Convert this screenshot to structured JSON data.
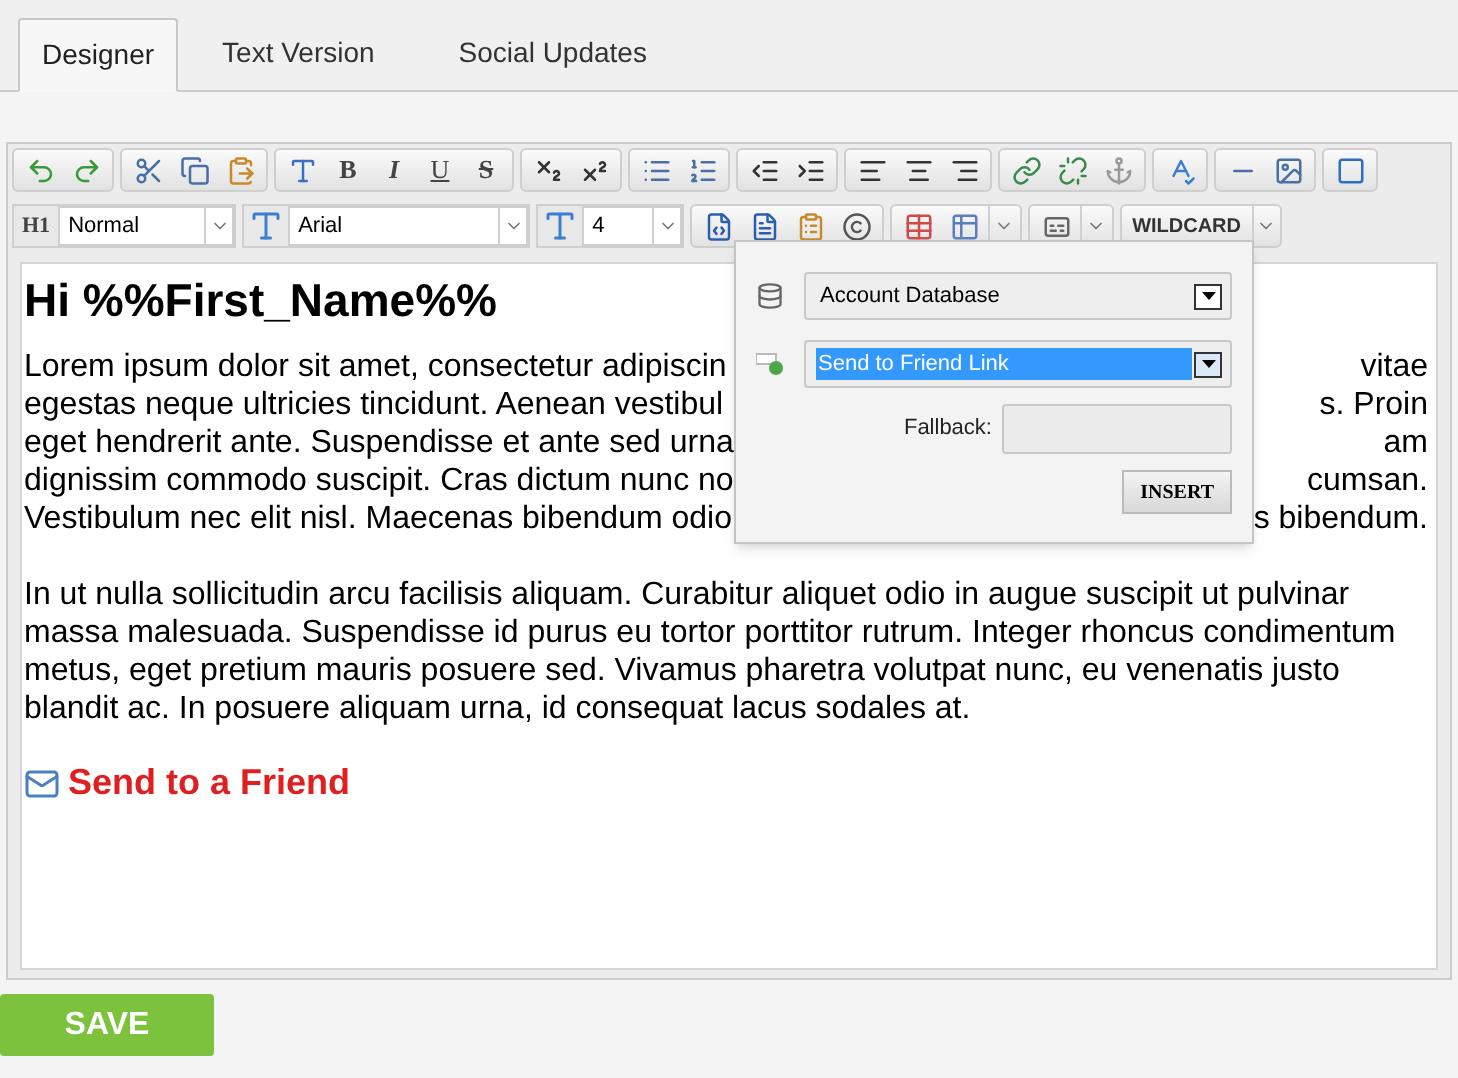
{
  "tabs": [
    {
      "label": "Designer",
      "selected": true
    },
    {
      "label": "Text Version",
      "selected": false
    },
    {
      "label": "Social Updates",
      "selected": false
    }
  ],
  "toolbar": {
    "style_buttons": [
      "B",
      "I",
      "U",
      "S"
    ],
    "heading_label": "H1",
    "format": "Normal",
    "font": "Arial",
    "size": "4",
    "wildcard": "WILDCARD"
  },
  "content": {
    "heading": "Hi %%First_Name%%",
    "paragraph_1_lines": [
      {
        "left": "Lorem ipsum dolor sit amet, consectetur adipiscin",
        "right": "vitae"
      },
      {
        "left": "egestas neque ultricies tincidunt. Aenean vestibul",
        "right": "s. Proin"
      },
      {
        "left": "eget hendrerit ante. Suspendisse et ante sed urna",
        "right": "am"
      },
      {
        "left": "dignissim commodo suscipit. Cras dictum nunc no",
        "right": "cumsan."
      },
      {
        "left": "Vestibulum nec elit nisl. Maecenas bibendum odio",
        "right": "s bibendum."
      }
    ],
    "paragraph_2": "In ut nulla sollicitudin arcu facilisis aliquam. Curabitur aliquet odio in augue suscipit ut pulvinar massa malesuada. Suspendisse id purus eu tortor porttitor rutrum. Integer rhoncus condimentum metus, eget pretium mauris posuere sed. Vivamus pharetra volutpat nunc, eu venenatis justo blandit ac. In posuere aliquam urna, id consequat lacus sodales at.",
    "link": "Send to a Friend"
  },
  "wildcard_popup": {
    "database": "Account Database",
    "field": "Send to Friend Link",
    "fallback_label": "Fallback:",
    "button": "INSERT"
  },
  "save_button": "SAVE"
}
